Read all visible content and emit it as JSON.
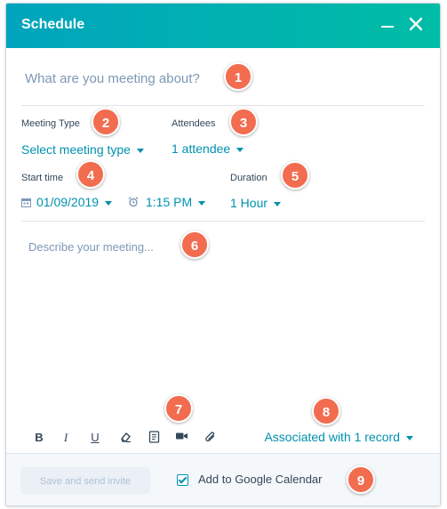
{
  "window": {
    "title": "Schedule"
  },
  "subject": {
    "placeholder": "What are you meeting about?"
  },
  "meeting_type": {
    "label": "Meeting Type",
    "value": "Select meeting type"
  },
  "attendees": {
    "label": "Attendees",
    "value": "1 attendee"
  },
  "start_time": {
    "label": "Start time",
    "date": "01/09/2019",
    "time": "1:15 PM"
  },
  "duration": {
    "label": "Duration",
    "value": "1 Hour"
  },
  "description": {
    "placeholder": "Describe your meeting..."
  },
  "toolbar": {
    "bold": "B",
    "italic": "I",
    "underline": "U",
    "associations_label": "Associated with 1 record"
  },
  "footer": {
    "save_label": "Save and send invite",
    "google_calendar_label": "Add to Google Calendar",
    "google_calendar_checked": true
  },
  "callouts": [
    "1",
    "2",
    "3",
    "4",
    "5",
    "6",
    "7",
    "8",
    "9"
  ],
  "colors": {
    "header_start": "#00a4bd",
    "header_end": "#00bda5",
    "link": "#0091ae",
    "callout": "#f26c4f"
  }
}
